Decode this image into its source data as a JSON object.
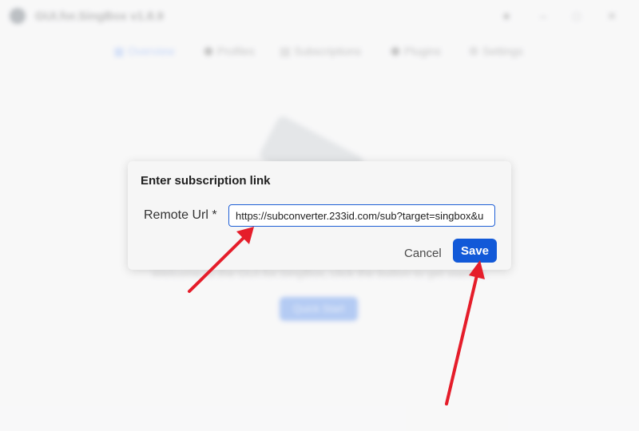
{
  "window": {
    "title": "GUI.for.SingBox v1.8.9",
    "controls": [
      "pin-icon",
      "minimize-icon",
      "maximize-icon",
      "close-icon"
    ]
  },
  "nav": {
    "items": [
      {
        "label": "Overview",
        "icon": "grid-icon",
        "active": true
      },
      {
        "label": "Profiles",
        "icon": "cube-icon",
        "active": false
      },
      {
        "label": "Subscriptions",
        "icon": "list-icon",
        "active": false
      },
      {
        "label": "Plugins",
        "icon": "puzzle-icon",
        "active": false
      },
      {
        "label": "Settings",
        "icon": "gear-icon",
        "active": false
      }
    ]
  },
  "main": {
    "welcome_text": "Welcome to the GUI.for.SingBox, click the button to get started.",
    "quick_start_label": "Quick Start"
  },
  "dialog": {
    "title": "Enter subscription link",
    "field_label": "Remote Url *",
    "url_value": "https://subconverter.233id.com/sub?target=singbox&u",
    "cancel_label": "Cancel",
    "save_label": "Save"
  },
  "colors": {
    "accent": "#1259d8",
    "annotation_arrow": "#e51d2a"
  }
}
